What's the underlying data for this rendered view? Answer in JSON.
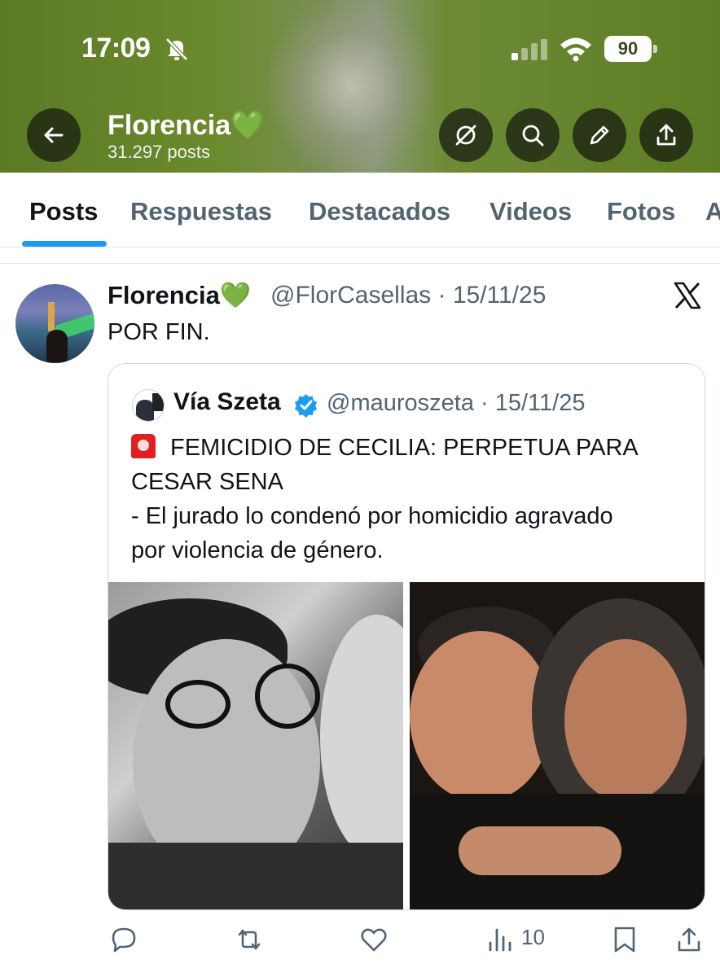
{
  "status_bar": {
    "time": "17:09",
    "battery": "90",
    "icons": [
      "bell-off-icon",
      "signal-icon",
      "wifi-icon",
      "battery-icon"
    ]
  },
  "header": {
    "name": "Florencia💚",
    "posts_count": "31.297 posts",
    "buttons": [
      "back-arrow-icon",
      "grok-icon",
      "search-icon",
      "edit-icon",
      "share-icon"
    ]
  },
  "tabs": [
    {
      "label": "Posts",
      "active": true
    },
    {
      "label": "Respuestas",
      "active": false
    },
    {
      "label": "Destacados",
      "active": false
    },
    {
      "label": "Videos",
      "active": false
    },
    {
      "label": "Fotos",
      "active": false
    },
    {
      "label": "A",
      "active": false
    }
  ],
  "tweet": {
    "author_name": "Florencia💚",
    "handle_date": "@FlorCasellas · 15/11/25",
    "text": "POR FIN.",
    "quote": {
      "author_name": "Vía Szeta",
      "handle_date": "@mauroszeta · 15/11/25",
      "lines": [
        "FEMICIDIO DE CECILIA: PERPETUA PARA",
        "CESAR SENA",
        "- El jurado lo condenó por homicidio agravado",
        "por violencia de género."
      ]
    },
    "actions": {
      "views": "10"
    }
  },
  "colors": {
    "accent": "#1d9bf0",
    "text_secondary": "#536471",
    "banner": "#6b8a2c",
    "verified": "#1d9bf0"
  }
}
